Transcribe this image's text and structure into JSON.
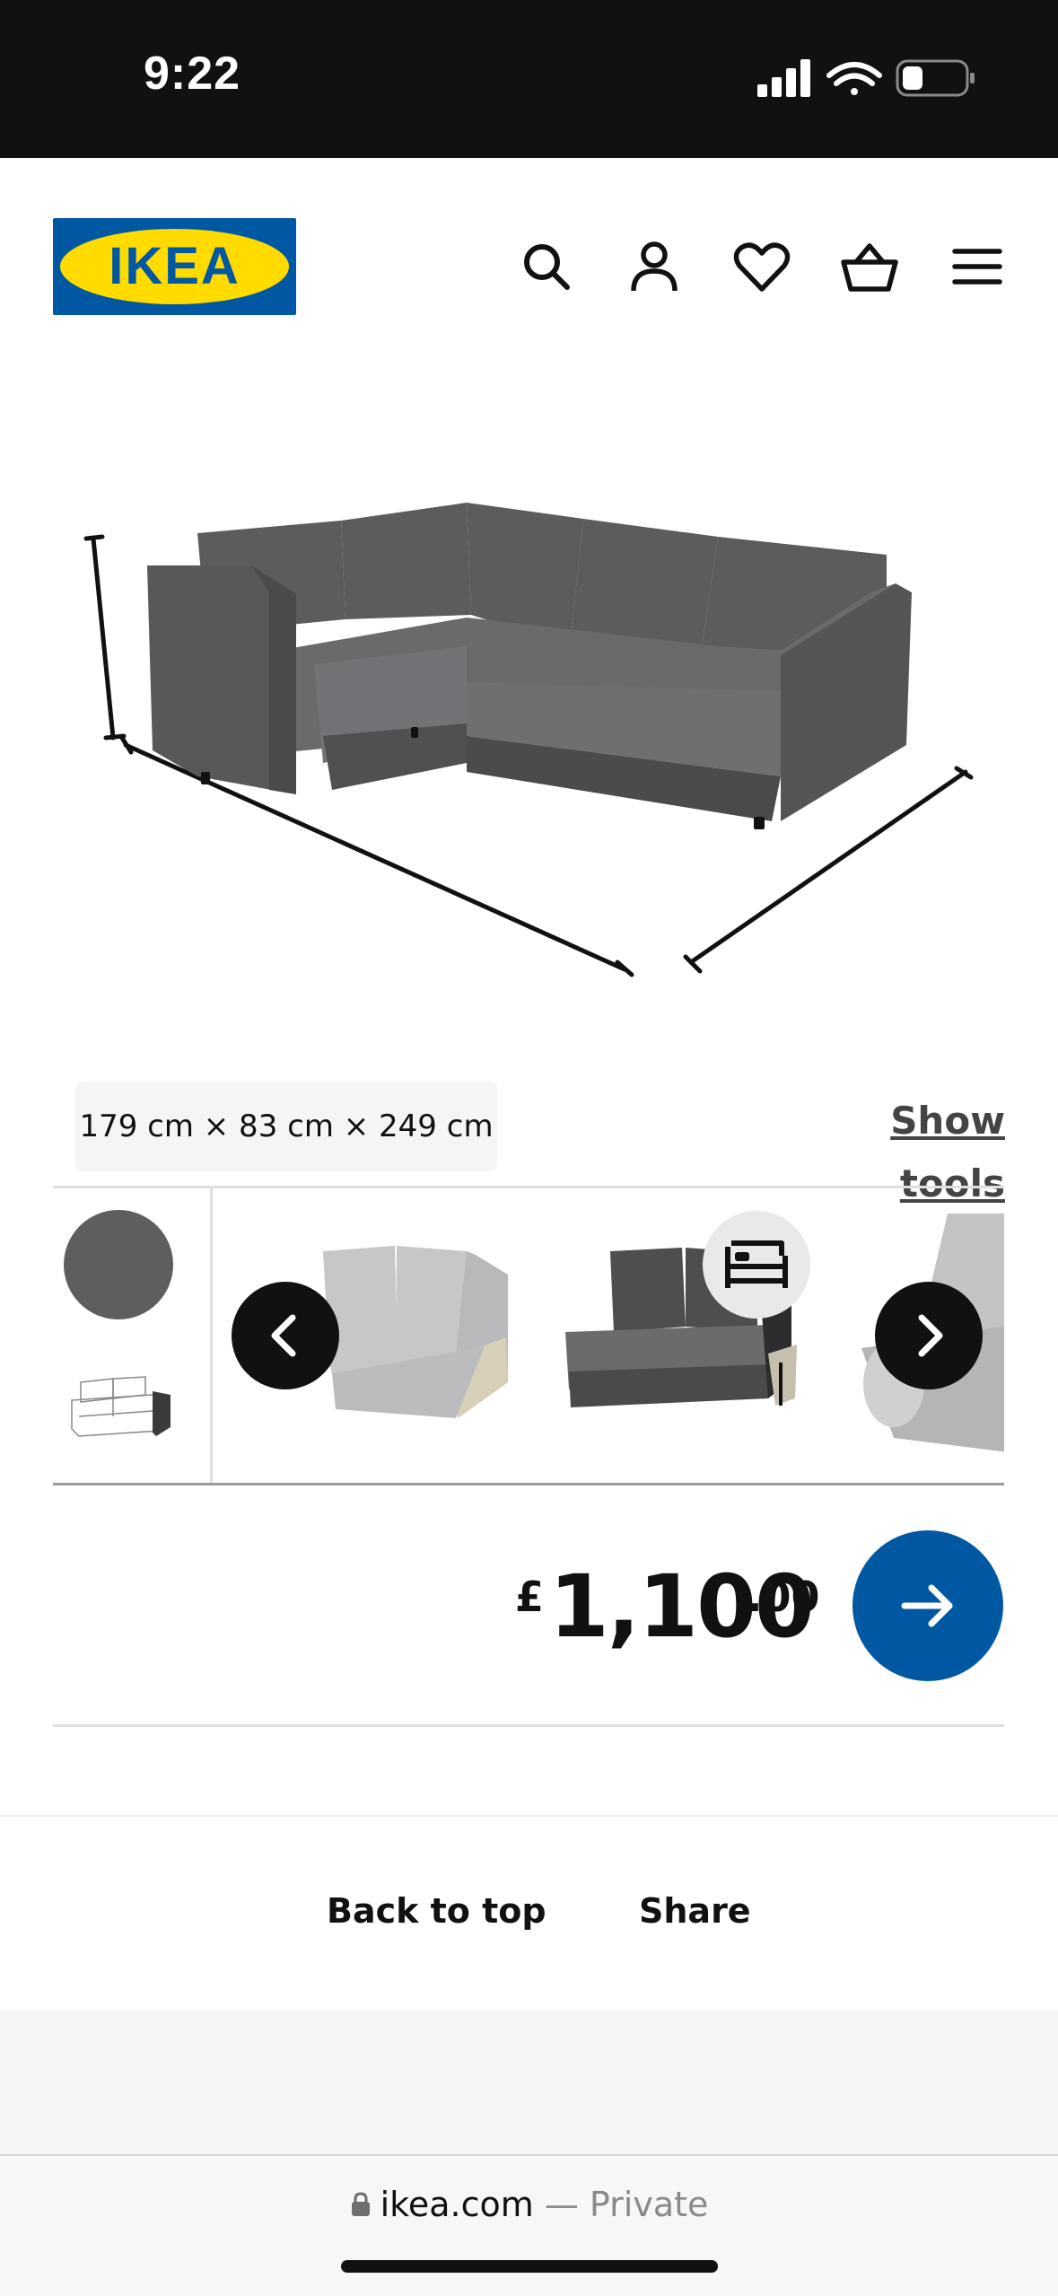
{
  "status_bar": {
    "time": "9:22"
  },
  "header": {
    "logo_text": "IKEA",
    "icons": [
      "search-icon",
      "account-icon",
      "heart-icon",
      "basket-icon",
      "menu-icon"
    ]
  },
  "product": {
    "dimensions": "179 cm × 83 cm × 249 cm",
    "show_tools": "Show tools"
  },
  "configurator": {
    "selected_color": "#5e5e5e",
    "icons": [
      "chevron-left-icon",
      "chevron-right-icon",
      "sofa-bed-icon"
    ]
  },
  "price": {
    "currency": "£",
    "integer": "1,100",
    "decimal": ".00"
  },
  "footer": {
    "back_to_top": "Back to top",
    "share": "Share"
  },
  "browser": {
    "domain": "ikea.com",
    "mode": "— Private"
  },
  "colors": {
    "brand_blue": "#0058a3",
    "brand_yellow": "#ffdb00",
    "sofa_grey": "#5e5e5e"
  }
}
